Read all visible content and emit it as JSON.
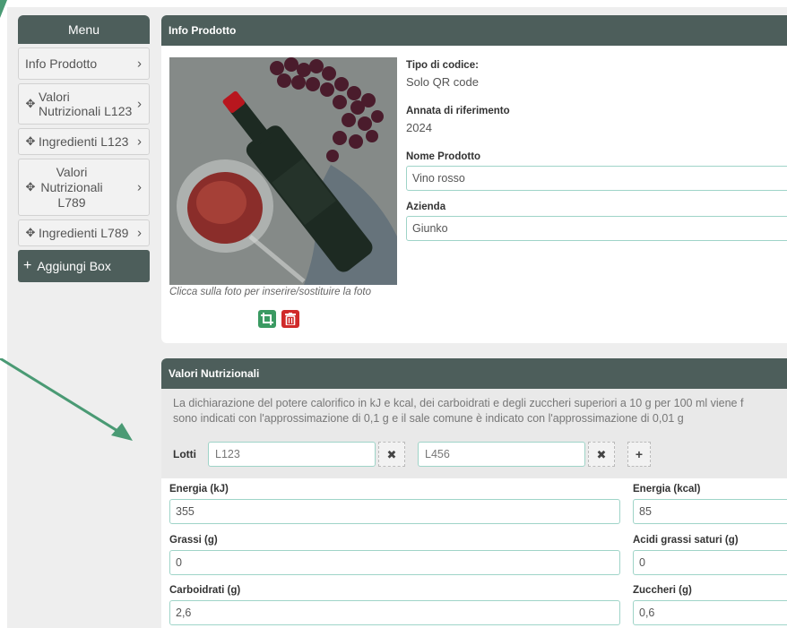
{
  "sidebar": {
    "menu_title": "Menu",
    "items": [
      {
        "label": "Info Prodotto",
        "movable": false
      },
      {
        "label": "Valori Nutrizionali L123",
        "movable": true
      },
      {
        "label": "Ingredienti L123",
        "movable": true
      },
      {
        "label": "Valori Nutrizionali L789",
        "movable": true
      },
      {
        "label": "Ingredienti L789",
        "movable": true
      }
    ],
    "add_box_label": "Aggiungi Box"
  },
  "info_prodotto": {
    "title": "Info Prodotto",
    "photo_caption": "Clicca sulla foto per inserire/sostituire la foto",
    "tipo_codice_label": "Tipo di codice:",
    "tipo_codice_value": "Solo QR code",
    "annata_label": "Annata di riferimento",
    "annata_value": "2024",
    "nome_label": "Nome Prodotto",
    "nome_value": "Vino rosso",
    "azienda_label": "Azienda",
    "azienda_value": "Giunko"
  },
  "valori_nutrizionali": {
    "title": "Valori Nutrizionali",
    "notice_line1": "La dichiarazione del potere calorifico in kJ e kcal, dei carboidrati e degli zuccheri superiori a 10 g per 100 ml viene f",
    "notice_line2": "sono indicati con l'approssimazione di 0,1 g e il sale comune è indicato con l'approssimazione di 0,01 g",
    "lotti_label": "Lotti",
    "lotti": [
      "L123",
      "L456"
    ],
    "fields": {
      "energia_kj_label": "Energia (kJ)",
      "energia_kj": "355",
      "energia_kcal_label": "Energia (kcal)",
      "energia_kcal": "85",
      "grassi_label": "Grassi (g)",
      "grassi": "0",
      "acidi_label": "Acidi grassi saturi (g)",
      "acidi": "0",
      "carboidrati_label": "Carboidrati (g)",
      "carboidrati": "2,6",
      "zuccheri_label": "Zuccheri (g)",
      "zuccheri": "0,6"
    }
  },
  "colors": {
    "header": "#4d5e5b",
    "accent_arrow": "#4a9a74",
    "input_border": "#9fd4c8",
    "crop_button": "#3a9a62",
    "delete_button": "#d02a2a"
  }
}
